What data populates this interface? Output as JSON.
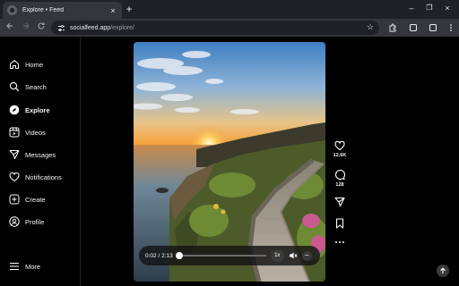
{
  "browser": {
    "tab_title": "Explore • Feed",
    "tab_close": "×",
    "new_tab": "+",
    "url_domain": "socialfeed.app",
    "url_path": "/explore/",
    "window_controls": [
      "–",
      "❐",
      "×"
    ]
  },
  "sidebar": {
    "items": [
      {
        "label": "Home",
        "icon": "home-icon"
      },
      {
        "label": "Search",
        "icon": "search-icon"
      },
      {
        "label": "Explore",
        "icon": "compass-icon",
        "active": true
      },
      {
        "label": "Videos",
        "icon": "video-icon"
      },
      {
        "label": "Messages",
        "icon": "send-icon"
      },
      {
        "label": "Notifications",
        "icon": "heart-icon"
      },
      {
        "label": "Create",
        "icon": "plus-square-icon"
      },
      {
        "label": "Profile",
        "icon": "profile-icon"
      }
    ],
    "more": {
      "label": "More",
      "icon": "menu-icon"
    }
  },
  "player": {
    "current_time": "0:02",
    "duration": "2:13",
    "time_display": "0:02 / 2:13",
    "progress": 0.015,
    "speed": "1x",
    "minimize": "−"
  },
  "actions": {
    "likes": "12.6K",
    "comments": "128"
  },
  "colors": {
    "background": "#000000",
    "chrome_dark": "#202124",
    "chrome_light": "#35363a",
    "controls_bg": "#141414"
  }
}
